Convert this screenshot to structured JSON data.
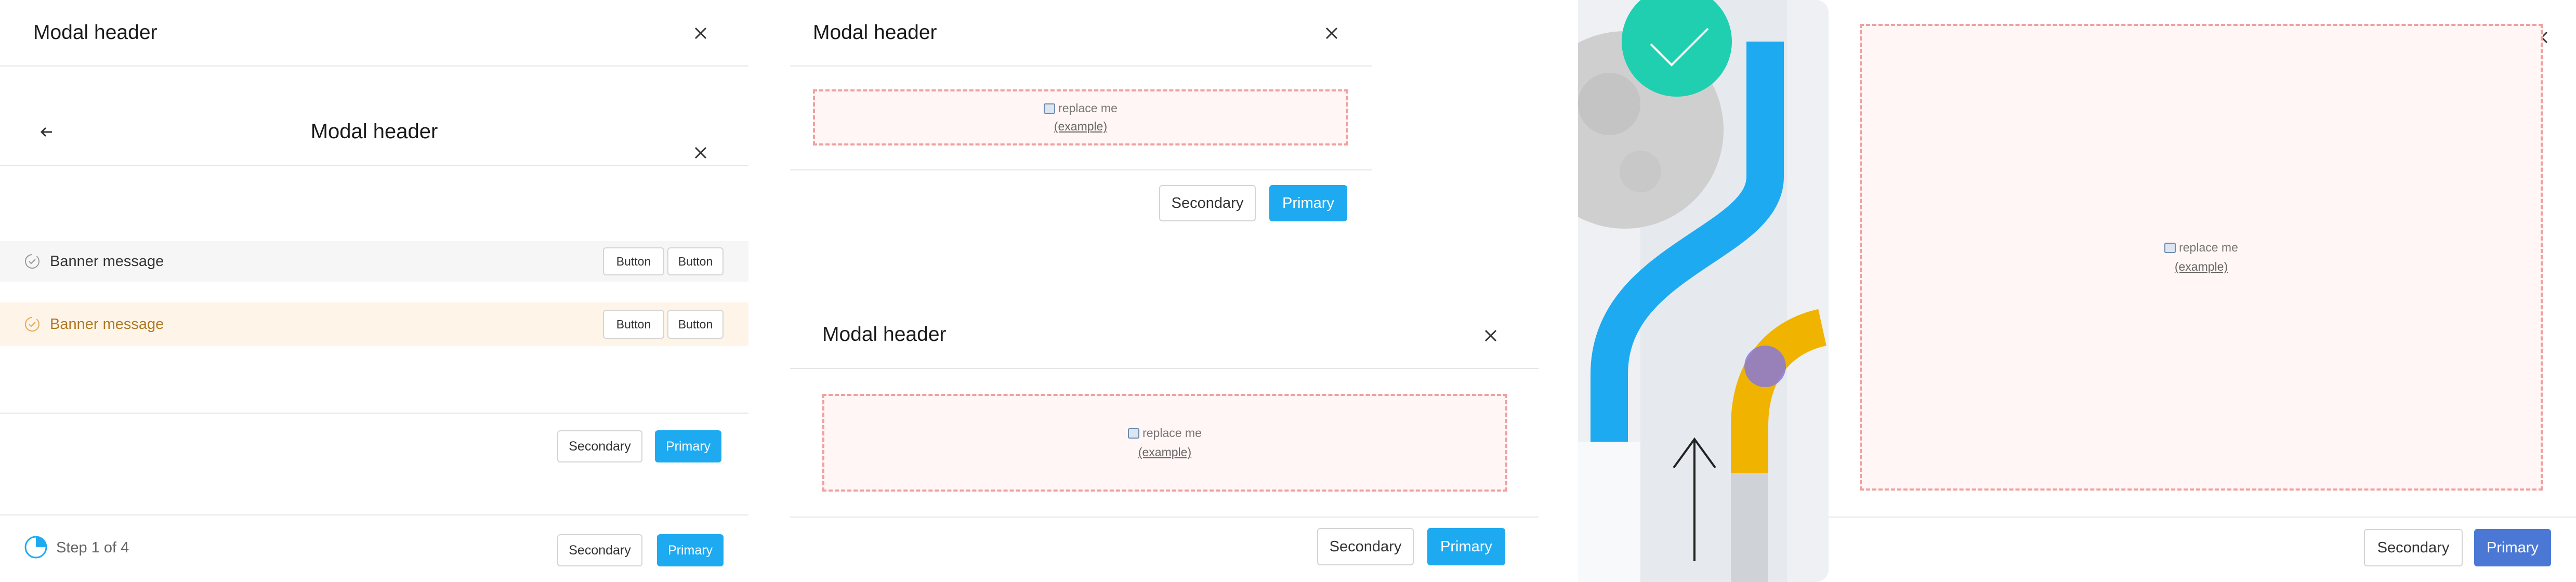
{
  "modal1": {
    "title": "Modal header",
    "close_icon": "close-icon"
  },
  "modal2": {
    "title": "Modal header",
    "back_icon": "arrow-left-icon",
    "close_icon": "close-icon",
    "banners": [
      {
        "message": "Banner message",
        "button1": "Button",
        "button2": "Button",
        "color": "#f6f6f6"
      },
      {
        "message": "Banner message",
        "button1": "Button",
        "button2": "Button",
        "color": "#fff4e8"
      }
    ],
    "secondary": "Secondary",
    "primary": "Primary"
  },
  "stepper_footer": {
    "step_text": "Step 1 of 4",
    "secondary": "Secondary",
    "primary": "Primary",
    "progress": 0.25
  },
  "modal3": {
    "title": "Modal header",
    "placeholder": {
      "text": "replace me",
      "link": "(example)"
    },
    "secondary": "Secondary",
    "primary": "Primary"
  },
  "modal4": {
    "title": "Modal header",
    "placeholder": {
      "text": "replace me",
      "link": "(example)"
    },
    "secondary": "Secondary",
    "primary": "Primary"
  },
  "modal5": {
    "placeholder": {
      "text": "replace me",
      "link": "(example)"
    },
    "secondary": "Secondary",
    "primary": "Primary"
  },
  "colors": {
    "primary": "#1eaaf1",
    "primary_alt": "#4a78d4",
    "placeholder_border": "#f0a0a0",
    "accent_teal": "#1fcfb0",
    "accent_yellow": "#f0b400"
  }
}
